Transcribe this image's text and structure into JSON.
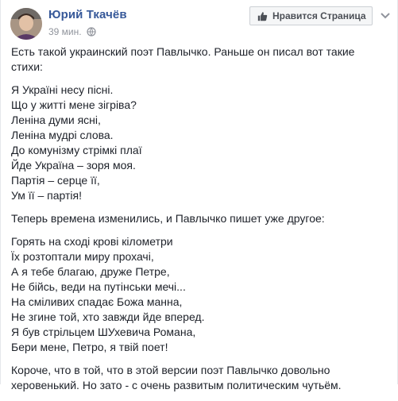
{
  "post": {
    "author_name": "Юрий Ткачёв",
    "timestamp": "39 мин.",
    "like_page_label": "Нравится Страница",
    "intro_paragraph": "Есть такой украинский поэт Павлычко. Раньше он писал вот такие стихи:",
    "poem_old": [
      "Я Україні несу пісні.",
      "Що у житті мене зігріва?",
      "Леніна думи ясні,",
      "Леніна мудрі слова.",
      "До комунізму стрімкі плаї",
      "Йде Україна – зоря моя.",
      "Партія – серце її,",
      "Ум її – партія!"
    ],
    "middle_paragraph": "Теперь времена изменились, и Павлычко пишет уже другое:",
    "poem_new": [
      "Горять на сході крові кілометри",
      "Їх розтоптали миру прохачі,",
      "А я тебе благаю, друже Петре,",
      "Не бійсь, веди на путінськи мечі...",
      "На сміливих спадає Божа манна,",
      "Не згине той, хто завжди йде вперед.",
      "Я був стрільцем ШУхевича Романа,",
      "Бери мене, Петро, я твій поет!"
    ],
    "closing_paragraph": "Короче, что в той, что в этой версии поэт Павлычко довольно херовенький. Но зато - с очень развитым политическим чутьём."
  },
  "icons": {
    "avatar": "user-avatar",
    "audience": "globe-icon",
    "like": "thumbs-up-icon",
    "menu": "chevron-down-icon"
  },
  "colors": {
    "author_link": "#365899",
    "meta_text": "#90949c",
    "body_text": "#1d2129",
    "button_bg": "#f5f6f7",
    "button_border": "#ccd0d5"
  }
}
